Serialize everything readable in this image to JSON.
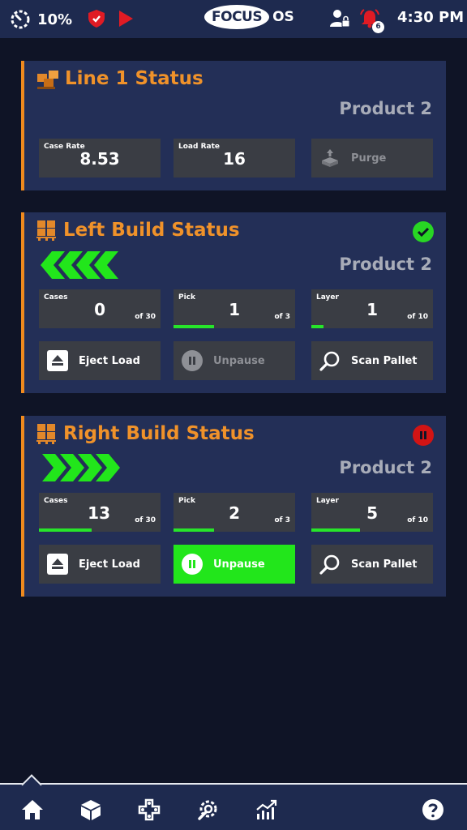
{
  "status_bar": {
    "battery_percent": "10%",
    "logo_text": "FOCUS",
    "logo_suffix": "OS",
    "alarm_count": "6",
    "time": "4:30 PM"
  },
  "line1": {
    "title": "Line 1 Status",
    "product": "Product 2",
    "case_rate_label": "Case Rate",
    "case_rate_value": "8.53",
    "load_rate_label": "Load Rate",
    "load_rate_value": "16",
    "purge_label": "Purge"
  },
  "left_build": {
    "title": "Left Build Status",
    "product": "Product 2",
    "status": "ok",
    "direction": "left",
    "cases_label": "Cases",
    "cases_value": "0",
    "cases_of": "of 30",
    "cases_progress": 0.0,
    "pick_label": "Pick",
    "pick_value": "1",
    "pick_of": "of 3",
    "pick_progress": 0.333,
    "layer_label": "Layer",
    "layer_value": "1",
    "layer_of": "of 10",
    "layer_progress": 0.1,
    "eject_label": "Eject Load",
    "unpause_label": "Unpause",
    "unpause_enabled": false,
    "scan_label": "Scan Pallet"
  },
  "right_build": {
    "title": "Right Build Status",
    "product": "Product 2",
    "status": "paused",
    "direction": "right",
    "cases_label": "Cases",
    "cases_value": "13",
    "cases_of": "of 30",
    "cases_progress": 0.433,
    "pick_label": "Pick",
    "pick_value": "2",
    "pick_of": "of 3",
    "pick_progress": 0.333,
    "layer_label": "Layer",
    "layer_value": "5",
    "layer_of": "of 10",
    "layer_progress": 0.4,
    "eject_label": "Eject Load",
    "unpause_label": "Unpause",
    "unpause_enabled": true,
    "scan_label": "Scan Pallet"
  },
  "nav": {
    "items": [
      "home-icon",
      "package-icon",
      "gamepad-icon",
      "wrench-gear-icon",
      "trend-chart-icon",
      "help-icon"
    ],
    "active": "home-icon"
  },
  "colors": {
    "accent_orange": "#f08a1e",
    "panel_bg": "#232f57",
    "tile_bg": "#3a3d44",
    "progress_green": "#27e52a",
    "active_button": "#22e61b",
    "alert_red": "#d21414"
  }
}
